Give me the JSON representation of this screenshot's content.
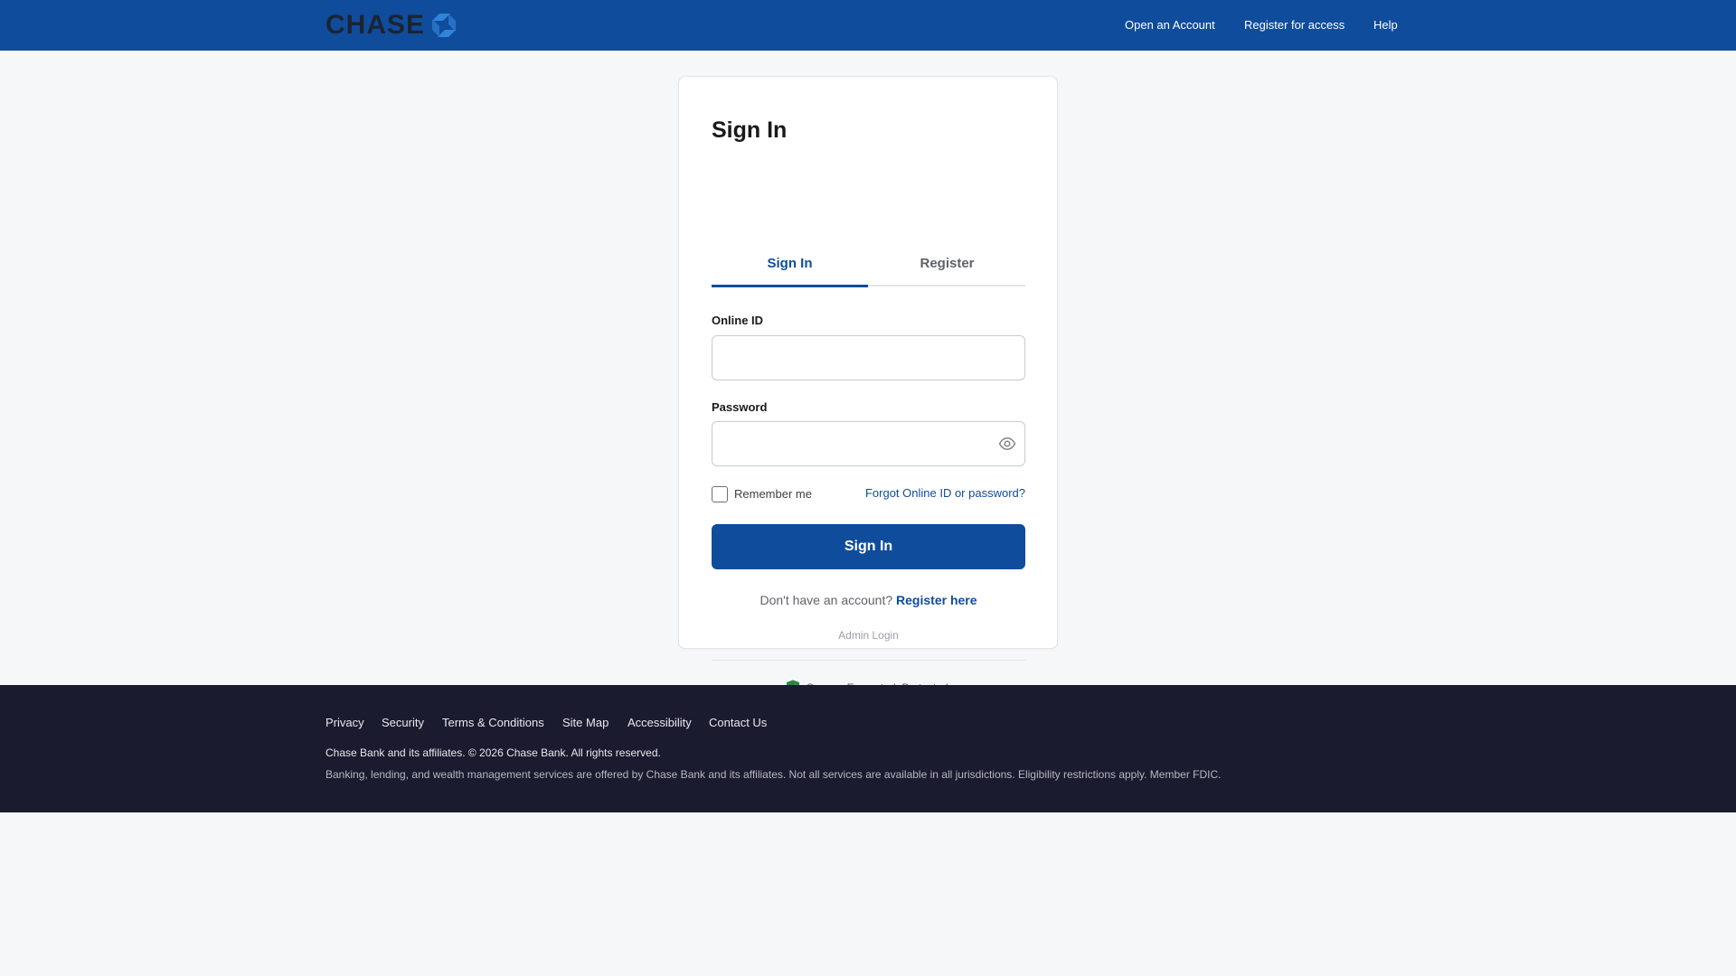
{
  "header": {
    "logo_text": "CHASE",
    "nav": [
      "Open an Account",
      "Register for access",
      "Help"
    ]
  },
  "card": {
    "title": "Sign In",
    "tabs": [
      {
        "label": "Sign In",
        "active": true
      },
      {
        "label": "Register",
        "active": false
      }
    ],
    "online_id": {
      "label": "Online ID",
      "value": "",
      "placeholder": ""
    },
    "password": {
      "label": "Password",
      "value": "",
      "placeholder": ""
    },
    "remember_label": "Remember me",
    "remember_checked": false,
    "forgot_link": "Forgot Online ID or password?",
    "submit_label": "Sign In",
    "no_account_text": "Don't have an account?",
    "register_link": "Register here",
    "admin_link": "Admin Login",
    "secure_text": "Secure. Encrypted. Protected."
  },
  "footer": {
    "links": [
      "Privacy",
      "Security",
      "Terms & Conditions",
      "Site Map",
      "Accessibility",
      "Contact Us"
    ],
    "copyright": "Chase Bank and its affiliates. © 2026 Chase Bank. All rights reserved.",
    "disclaimer": "Banking, lending, and wealth management services are offered by Chase Bank and its affiliates. Not all services are available in all jurisdictions. Eligibility restrictions apply. Member FDIC."
  },
  "colors": {
    "brand_blue": "#0f4c9c",
    "footer_bg": "#1b1b2f",
    "page_bg": "#f6f7f9",
    "secure_green": "#2e8540"
  },
  "icons": [
    "chase-octagon-icon",
    "eye-icon",
    "shield-check-icon"
  ]
}
